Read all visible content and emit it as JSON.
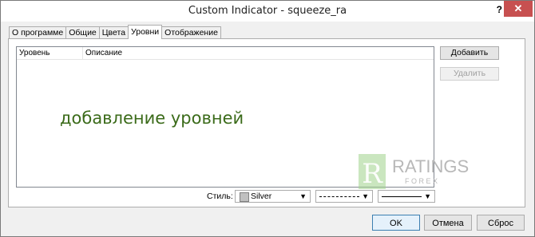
{
  "window": {
    "title": "Custom Indicator - squeeze_ra",
    "help_label": "?",
    "close_label": "✕"
  },
  "tabs": [
    {
      "label": "О программе"
    },
    {
      "label": "Общие"
    },
    {
      "label": "Цвета"
    },
    {
      "label": "Уровни",
      "active": true
    },
    {
      "label": "Отображение"
    }
  ],
  "levels_table": {
    "columns": [
      "Уровень",
      "Описание"
    ],
    "rows": []
  },
  "overlay_text": "добавление уровней",
  "logo": {
    "letter": "R",
    "brand": "RATINGS",
    "sub": "F O R E X"
  },
  "side_buttons": {
    "add": "Добавить",
    "delete": "Удалить"
  },
  "style_row": {
    "label": "Стиль:",
    "color_value": "Silver",
    "color_hex": "#c0c0c0",
    "line_style": "dashed",
    "line_width": "thin"
  },
  "footer_buttons": {
    "ok": "OK",
    "cancel": "Отмена",
    "reset": "Сброс"
  }
}
